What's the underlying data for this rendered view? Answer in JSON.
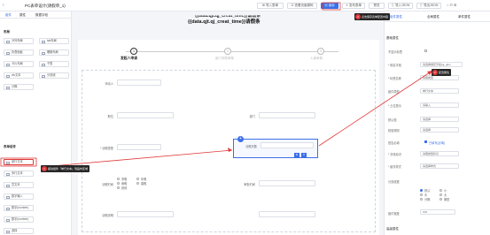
{
  "header": {
    "title": "PC表单设计(请假单_1)",
    "tabs": [
      "组件",
      "属性",
      "数据字段"
    ],
    "buttons": {
      "import": "导入表单",
      "code": "查看页面源码",
      "save": "保存",
      "publish": "发布表单",
      "preview": "预览",
      "import_json": "导入JSON",
      "export_json": "导出JSON"
    }
  },
  "template_text": {
    "line1": "{{data.qjt.qj_creat_time}}请假条",
    "line2": "{{data.qjt.qj_creat_time}}请假条"
  },
  "tips": {
    "save": {
      "num": "3",
      "text": "点击保存表单配置内容"
    },
    "drag": {
      "num": "1",
      "text": "拖动组件「单行文本」到画布区域"
    },
    "config": {
      "num": "2",
      "text": "配置属性"
    }
  },
  "left": {
    "layout_title": "布局",
    "layout_items": [
      "分列布局",
      "tab布局",
      "折叠面板",
      "栅格布局",
      "卡片布局",
      "子表",
      "div文本",
      "分割线",
      "分隔"
    ],
    "form_title": "表单组件",
    "form_items": [
      "单行文本",
      "多行文本",
      "富文本",
      "数字输入",
      "数字(number)",
      "数字(number)",
      "选择"
    ]
  },
  "steps": [
    {
      "num": "1",
      "label": "发起人申请"
    },
    {
      "num": "2",
      "label": "部门领导审核"
    },
    {
      "num": "3",
      "label": "人事审核"
    }
  ],
  "form": {
    "l1": "申请人",
    "l2": "职位",
    "l3": "部门",
    "l4": "* 请假类型",
    "l5": "请假天数",
    "l6": "请假时间",
    "l7": "审批时间",
    "l8": "请假说明",
    "radio_labels": [
      "事假",
      "年假",
      "病假",
      "婚假",
      "其他"
    ]
  },
  "right": {
    "tabs": [
      "组件属性",
      "全局属性",
      "单件属性"
    ],
    "basic_title": "基础属性",
    "rows": [
      {
        "label": "不显示标签",
        "value": ""
      },
      {
        "label": "* 绑定字段",
        "value": "请选择绑定字段(qj_qjlx)"
      },
      {
        "label": "* 标签名称",
        "value": "请假类型"
      },
      {
        "label": "组件类型",
        "value": "单行文本"
      },
      {
        "label": "* 占位提示",
        "value": "请输入"
      },
      {
        "label": "默认值",
        "value": "请选择"
      },
      {
        "label": "校验规则",
        "value": "请选择"
      }
    ],
    "required_label": "是否必填",
    "required_value": "已填写(必填)",
    "more_rows": [
      {
        "label": "* 字段标识",
        "value": "请假类型标识"
      },
      {
        "label": "* 组件样式",
        "value": "请选择样式"
      },
      {
        "label": "分割线宽",
        "value": ""
      }
    ],
    "radio_opts": [
      "默认",
      "小",
      "中",
      "大",
      "分隔",
      "微型"
    ],
    "advanced_title": "高级属性",
    "advanced_value": "100",
    "advanced_label": "组件宽度"
  }
}
